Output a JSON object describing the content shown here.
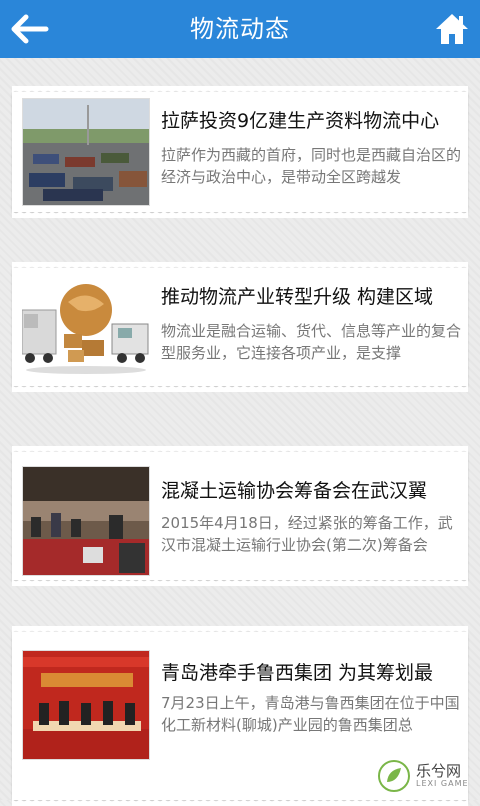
{
  "header": {
    "title": "物流动态",
    "back_icon": "arrow-left-icon",
    "home_icon": "home-icon",
    "bg_color": "#2a86d9"
  },
  "articles": [
    {
      "title": "拉萨投资9亿建生产资料物流中心",
      "desc": "拉萨作为西藏的首府，同时也是西藏自治区的经济与政治中心，是带动全区跨越发"
    },
    {
      "title": "推动物流产业转型升级 构建区域",
      "desc": "物流业是融合运输、货代、信息等产业的复合型服务业，它连接各项产业，是支撑"
    },
    {
      "title": "混凝土运输协会筹备会在武汉翼",
      "desc": "2015年4月18日，经过紧张的筹备工作，武汉市混凝土运输行业协会(第二次)筹备会"
    },
    {
      "title": "青岛港牵手鲁西集团 为其筹划最",
      "desc": "7月23日上午，青岛港与鲁西集团在位于中国化工新材料(聊城)产业园的鲁西集团总"
    }
  ],
  "watermark": {
    "text": "乐兮网",
    "sub": "LEXI GAME"
  }
}
